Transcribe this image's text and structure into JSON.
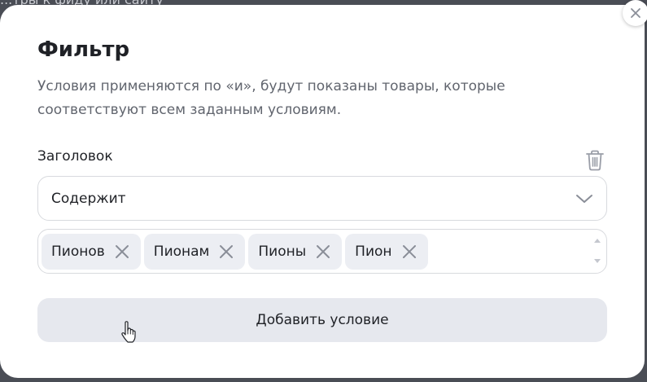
{
  "background": {
    "top_text": "...тры к фиду или сайту",
    "bottom_text": ""
  },
  "modal": {
    "title": "Фильтр",
    "description": "Условия применяются по «и», будут показаны товары, которые соответствуют всем заданным условиям.",
    "field_label": "Заголовок",
    "condition_select": {
      "value": "Содержит"
    },
    "tags": [
      {
        "label": "Пионов"
      },
      {
        "label": "Пионам"
      },
      {
        "label": "Пионы"
      },
      {
        "label": "Пион"
      }
    ],
    "add_condition_label": "Добавить условие"
  },
  "icons": {
    "close": "close-icon",
    "trash": "trash-icon",
    "dropdown": "chevron-down-icon",
    "tag_remove": "close-icon",
    "cursor": "hand-pointer-icon"
  },
  "colors": {
    "title": "#1f2126",
    "description": "#61656e",
    "tag_bg": "#eceef3",
    "button_bg": "#e6e8ee",
    "border": "#d8dade",
    "icon": "#8a8e98"
  }
}
